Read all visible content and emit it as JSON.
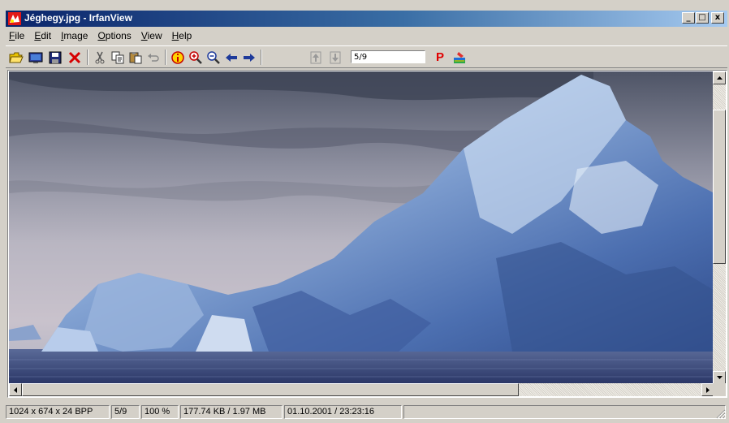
{
  "window": {
    "title": "Jéghegy.jpg - IrfanView",
    "caption_buttons": {
      "minimize": "_",
      "maximize": "□",
      "close": "x"
    }
  },
  "menu": [
    {
      "label": "File",
      "accel": "F",
      "rest": "ile"
    },
    {
      "label": "Edit",
      "accel": "E",
      "rest": "dit"
    },
    {
      "label": "Image",
      "accel": "I",
      "rest": "mage"
    },
    {
      "label": "Options",
      "accel": "O",
      "rest": "ptions"
    },
    {
      "label": "View",
      "accel": "V",
      "rest": "iew"
    },
    {
      "label": "Help",
      "accel": "H",
      "rest": "elp"
    }
  ],
  "toolbar": {
    "buttons": [
      "open-folder-icon",
      "slideshow-icon",
      "save-icon",
      "delete-icon",
      "cut-icon",
      "copy-icon",
      "paste-icon",
      "undo-icon",
      "info-icon",
      "zoom-in-icon",
      "zoom-out-icon",
      "previous-icon",
      "next-icon",
      "first-page-icon",
      "last-page-icon",
      "p-icon",
      "paint-icon"
    ],
    "page_value": "5/9",
    "p_label": "P"
  },
  "image": {
    "description_icon": "iceberg-photo"
  },
  "status": {
    "dimensions": "1024 x 674 x 24 BPP",
    "index": "5/9",
    "zoom": "100 %",
    "size": "177.74 KB / 1.97 MB",
    "datetime": "01.10.2001 / 23:23:16"
  },
  "colors": {
    "title_gradient_start": "#0a246a",
    "title_gradient_end": "#a6caf0",
    "chrome": "#d4d0c8"
  }
}
